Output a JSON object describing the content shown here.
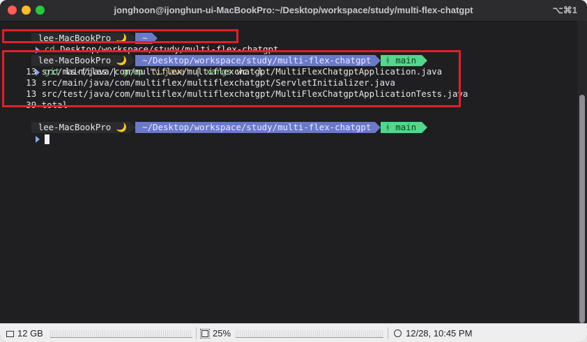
{
  "window": {
    "title": "jonghoon@ijonghun-ui-MacBookPro:~/Desktop/workspace/study/multi-flex-chatgpt",
    "shortcut": "⌥⌘1"
  },
  "terminal": {
    "prompt1": {
      "host": "lee-MacBookPro",
      "moon": "🌙",
      "path": "~"
    },
    "cmd1": {
      "verb": "cd",
      "arg": "Desktop/workspace/study/multi-flex-chatgpt"
    },
    "prompt2": {
      "host": "lee-MacBookPro",
      "moon": "🌙",
      "path": "~/Desktop/workspace/study/multi-flex-chatgpt",
      "branch": "main",
      "branch_icon": "ᚼ"
    },
    "cmd2": {
      "git": "git",
      "lsfiles": "ls-files",
      "pipe1": "|",
      "grep": "grep",
      "pattern": "'\\.java'",
      "pipe2": "|",
      "xargs": "xargs",
      "wc": "wc -l"
    },
    "output": [
      "     13 src/main/java/com/multiflex/multiflexchatgpt/MultiFlexChatgptApplication.java",
      "     13 src/main/java/com/multiflex/multiflexchatgpt/ServletInitializer.java",
      "     13 src/test/java/com/multiflex/multiflexchatgpt/MultiFlexChatgptApplicationTests.java",
      "     39 total"
    ],
    "prompt3": {
      "host": "lee-MacBookPro",
      "moon": "🌙",
      "path": "~/Desktop/workspace/study/multi-flex-chatgpt",
      "branch": "main",
      "branch_icon": "ᚼ"
    }
  },
  "statusbar": {
    "memory": "12 GB",
    "cpu": "25%",
    "clock": "12/28, 10:45 PM"
  },
  "colors": {
    "highlight": "#e0202a",
    "path_segment": "#6b79c9",
    "branch_segment": "#54d68d"
  }
}
